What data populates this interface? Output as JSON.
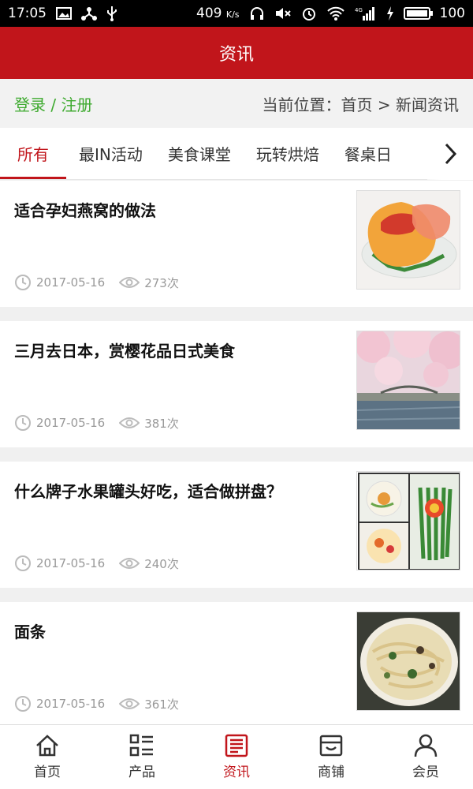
{
  "status": {
    "time": "17:05",
    "speed_value": "409",
    "speed_unit": "K/s",
    "network": "4G",
    "battery": "100"
  },
  "header": {
    "title": "资讯"
  },
  "locbar": {
    "login_label": "登录 / 注册",
    "location_label": "当前位置：首页 > 新闻资讯"
  },
  "tabs": [
    {
      "label": "所有"
    },
    {
      "label": "最IN活动"
    },
    {
      "label": "美食课堂"
    },
    {
      "label": "玩转烘焙"
    },
    {
      "label": "餐桌日"
    }
  ],
  "articles": [
    {
      "title": "适合孕妇燕窝的做法",
      "date": "2017-05-16",
      "views": "273次"
    },
    {
      "title": "三月去日本，赏樱花品日式美食",
      "date": "2017-05-16",
      "views": "381次"
    },
    {
      "title": "什么牌子水果罐头好吃，适合做拼盘？",
      "date": "2017-05-16",
      "views": "240次"
    },
    {
      "title": "面条",
      "date": "2017-05-16",
      "views": "361次"
    }
  ],
  "bottom_nav": [
    {
      "label": "首页",
      "icon": "home-icon"
    },
    {
      "label": "产品",
      "icon": "list-icon"
    },
    {
      "label": "资讯",
      "icon": "news-icon"
    },
    {
      "label": "商铺",
      "icon": "shop-icon"
    },
    {
      "label": "会员",
      "icon": "user-icon"
    }
  ],
  "colors": {
    "brand": "#c1151b",
    "login": "#3eaa2f"
  }
}
